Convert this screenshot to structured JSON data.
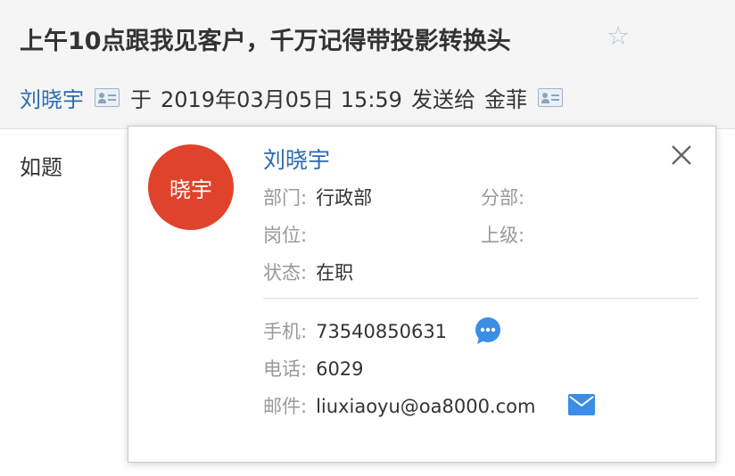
{
  "email": {
    "subject": "上午10点跟我见客户，千万记得带投影转换头",
    "sender": "刘晓宇",
    "sent_prefix": "于",
    "sent_time": "2019年03月05日 15:59",
    "sent_to_label": "发送给",
    "recipient": "金菲",
    "body": "如题"
  },
  "contact_card": {
    "avatar_text": "晓宇",
    "avatar_color": "#e0432b",
    "name": "刘晓宇",
    "fields": {
      "department_label": "部门:",
      "department": "行政部",
      "branch_label": "分部:",
      "branch": "",
      "position_label": "岗位:",
      "position": "",
      "superior_label": "上级:",
      "superior": "",
      "status_label": "状态:",
      "status": "在职",
      "mobile_label": "手机:",
      "mobile": "73540850631",
      "phone_label": "电话:",
      "phone": "6029",
      "email_label": "邮件:",
      "email": "liuxiaoyu@oa8000.com"
    }
  },
  "icons": {
    "star": "star-outline-icon",
    "card": "contact-card-icon",
    "close": "close-icon",
    "chat": "chat-bubble-icon",
    "mail": "mail-envelope-icon"
  },
  "colors": {
    "link_blue": "#2b6cb0",
    "icon_blue": "#3a8ee6",
    "label_gray": "#999999"
  }
}
